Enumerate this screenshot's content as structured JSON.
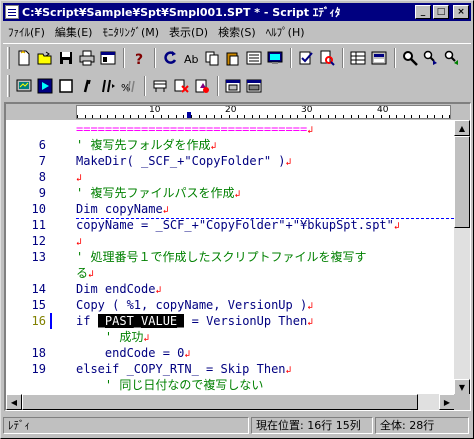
{
  "window": {
    "title": "C:¥Script¥Sample¥Spt¥Smpl001.SPT * - Script ｴﾃﾞｨﾀ",
    "minimize": "_",
    "maximize": "□",
    "close": "×"
  },
  "menu": [
    "ﾌｧｲﾙ(F)",
    "編集(E)",
    "ﾓﾆﾀﾘﾝｸﾞ(M)",
    "表示(D)",
    "検索(S)",
    "ﾍﾙﾌﾟ(H)"
  ],
  "toolbar1_icons": [
    "new-file-icon",
    "open-folder-icon",
    "save-icon",
    "print-icon",
    "properties-icon",
    "help-icon",
    "run-icon",
    "find-icon",
    "copy-icon",
    "paste-icon",
    "list-icon",
    "screen-icon",
    "check-icon",
    "search-doc-icon",
    "table-icon",
    "layout-icon",
    "zoom-icon",
    "find-next-icon",
    "find-prev-icon"
  ],
  "toolbar2_icons": [
    "monitor-icon",
    "play-icon",
    "stop-icon",
    "pause-icon",
    "step-icon",
    "step-over-icon",
    "debug-icon",
    "breakpoint-icon",
    "clear-break-icon",
    "window1-icon",
    "window2-icon"
  ],
  "ruler": [
    "10",
    "20",
    "30",
    "40"
  ],
  "editor": {
    "lines": [
      {
        "no": "",
        "text": "================================",
        "eol": "↲",
        "kind": "sep-line"
      },
      {
        "no": "6",
        "text": "' 複写先フォルダを作成",
        "eol": "↲",
        "kind": "comment"
      },
      {
        "no": "7",
        "text": "MakeDir( _SCF_+\"CopyFolder\" )",
        "eol": "↲",
        "kind": "code"
      },
      {
        "no": "8",
        "text": "",
        "eol": "↲",
        "kind": "code"
      },
      {
        "no": "9",
        "text": "' 複写先ファイルパスを作成",
        "eol": "↲",
        "kind": "comment"
      },
      {
        "no": "10",
        "text": "Dim copyName",
        "eol": "↲",
        "kind": "code"
      },
      {
        "no": "11",
        "text": "copyName = _SCF_+\"CopyFolder\"+\"¥bkupSpt.spt\"",
        "eol": "↲",
        "kind": "code"
      },
      {
        "no": "12",
        "text": "",
        "eol": "↲",
        "kind": "code"
      },
      {
        "no": "13",
        "text": "' 処理番号１で作成したスクリプトファイルを複写す",
        "eol": "",
        "kind": "comment"
      },
      {
        "no": "",
        "text": "る",
        "eol": "↲",
        "kind": "comment"
      },
      {
        "no": "14",
        "text": "Dim endCode",
        "eol": "↲",
        "kind": "code"
      },
      {
        "no": "15",
        "text": "Copy ( %1, copyName, VersionUp )",
        "eol": "↲",
        "kind": "code"
      },
      {
        "no": "16",
        "text_before": "if ",
        "text_hl": "_PAST_VALUE_",
        "text_after": " = VersionUp Then",
        "eol": "↲",
        "kind": "highlight"
      },
      {
        "no": "",
        "text": "    ' 成功",
        "eol": "↲",
        "kind": "comment"
      },
      {
        "no": "18",
        "text": "    endCode = 0",
        "eol": "↲",
        "kind": "code"
      },
      {
        "no": "19",
        "text": "elseif _COPY_RTN_ = Skip Then",
        "eol": "↲",
        "kind": "code"
      },
      {
        "no": "",
        "text": "    ' 同じ日付なので複写しない",
        "eol": "",
        "kind": "comment"
      }
    ]
  },
  "status": {
    "mode": "ﾚﾃﾞｨ",
    "position": "現在位置:  16行 15列",
    "total": "全体:  28行"
  }
}
